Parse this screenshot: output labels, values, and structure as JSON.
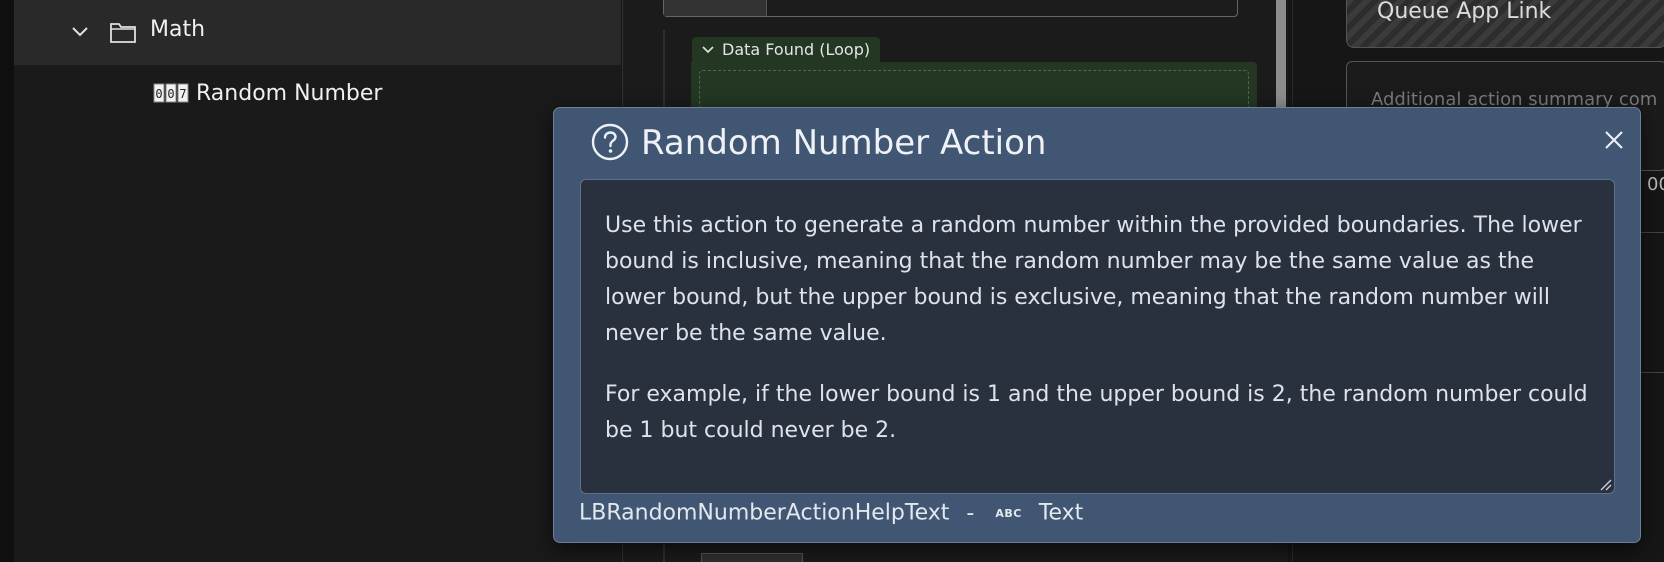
{
  "tree": {
    "folder": {
      "label": "Math",
      "icon": "folder-icon",
      "expand_icon": "chevron-down-icon"
    },
    "item": {
      "label": "Random Number",
      "icon": "numeric-counter-icon"
    }
  },
  "canvas": {
    "loop_block": {
      "label": "Data Found (Loop)",
      "icon": "chevron-down-icon",
      "accent": "#233723"
    }
  },
  "right_panel": {
    "queue_link_label": "Queue App Link",
    "summary_placeholder": "Additional action summary com",
    "partial_value": "00"
  },
  "dialog": {
    "title": "Random Number Action",
    "title_icon": "help-circle-icon",
    "close_icon": "close-icon",
    "help_paragraphs": [
      "Use this action to generate a random number within the provided boundaries. The lower bound is inclusive, meaning that the random number may be the same value as the lower bound, but the upper bound is exclusive, meaning that the random number will never be the same value.",
      "For example, if the lower bound is 1 and the upper bound is 2, the random number could be 1 but could never be 2."
    ],
    "footer": {
      "key": "LBRandomNumberActionHelpText",
      "separator": "-",
      "type_icon_text": "ABC",
      "type_label": "Text"
    },
    "colors": {
      "background": "#405672",
      "textarea": "#29313f"
    }
  }
}
